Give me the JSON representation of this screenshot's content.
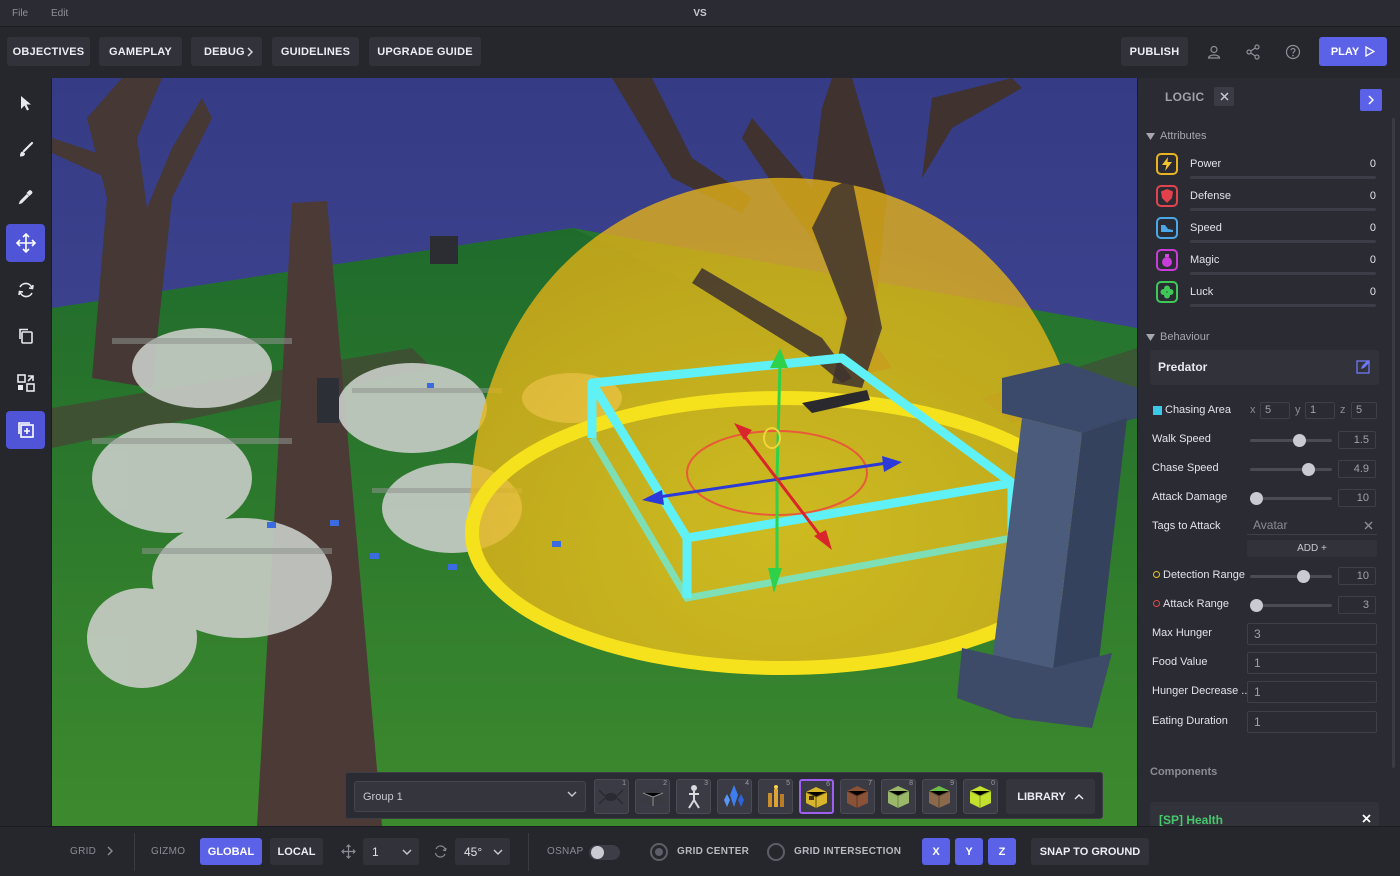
{
  "menu": {
    "file": "File",
    "edit": "Edit",
    "title": "VS"
  },
  "toolbar": {
    "objectives": "OBJECTIVES",
    "gameplay": "GAMEPLAY",
    "debug": "DEBUG",
    "guidelines": "GUIDELINES",
    "upgrade_guide": "UPGRADE GUIDE",
    "publish": "PUBLISH",
    "play": "PLAY",
    "icons": [
      "user-icon",
      "share-icon",
      "help-icon"
    ]
  },
  "tools": [
    "select-icon",
    "brush-icon",
    "eyedropper-icon",
    "move-icon",
    "rotate-icon",
    "copy-icon",
    "layout-icon",
    "add-frame-icon"
  ],
  "hotbar": {
    "group": "Group 1",
    "slot_numbers": [
      "1",
      "2",
      "3",
      "4",
      "5",
      "6",
      "7",
      "8",
      "9",
      "0"
    ],
    "library": "LIBRARY"
  },
  "bottom": {
    "grid": "GRID",
    "gizmo": "GIZMO",
    "global": "GLOBAL",
    "local": "LOCAL",
    "move_step": "1",
    "rotate_step": "45°",
    "osnap": "OSNAP",
    "grid_center": "GRID CENTER",
    "grid_intersection": "GRID INTERSECTION",
    "x": "X",
    "y": "Y",
    "z": "Z",
    "snap_to_ground": "SNAP TO GROUND"
  },
  "panel": {
    "title": "LOGIC",
    "attributes_header": "Attributes",
    "attributes": [
      {
        "label": "Power",
        "value": "0",
        "icon": "lightning-icon",
        "color": "#e8b322"
      },
      {
        "label": "Defense",
        "value": "0",
        "icon": "shield-icon",
        "color": "#e0444f"
      },
      {
        "label": "Speed",
        "value": "0",
        "icon": "shoe-icon",
        "color": "#4aa8e8"
      },
      {
        "label": "Magic",
        "value": "0",
        "icon": "potion-icon",
        "color": "#c83cd8"
      },
      {
        "label": "Luck",
        "value": "0",
        "icon": "clover-icon",
        "color": "#3fc858"
      }
    ],
    "behaviour_header": "Behaviour",
    "behaviour_name": "Predator",
    "chasing_area": {
      "label": "Chasing Area",
      "x_label": "x",
      "x": "5",
      "y_label": "y",
      "y": "1",
      "z_label": "z",
      "z": "5"
    },
    "walk_speed": {
      "label": "Walk Speed",
      "value": "1.5",
      "fraction": 0.62
    },
    "chase_speed": {
      "label": "Chase Speed",
      "value": "4.9",
      "fraction": 0.75
    },
    "attack_damage": {
      "label": "Attack Damage",
      "value": "10",
      "fraction": 0.0
    },
    "tags_to_attack": {
      "label": "Tags to Attack",
      "value": "Avatar"
    },
    "add": "ADD +",
    "detection_range": {
      "label": "Detection Range",
      "value": "10",
      "fraction": 0.68
    },
    "attack_range": {
      "label": "Attack Range",
      "value": "3",
      "fraction": 0.0
    },
    "max_hunger": {
      "label": "Max Hunger",
      "value": "3"
    },
    "food_value": {
      "label": "Food Value",
      "value": "1"
    },
    "hunger_decrease": {
      "label": "Hunger Decrease ...",
      "value": "1"
    },
    "eating_duration": {
      "label": "Eating Duration",
      "value": "1"
    },
    "components_header": "Components",
    "component": "[SP] Health"
  },
  "colors": {
    "accent": "#5b62e8",
    "health": "#46c96a",
    "chasing": "#3cc8e8",
    "detection": "#e8c21f",
    "attack": "#e04848"
  }
}
